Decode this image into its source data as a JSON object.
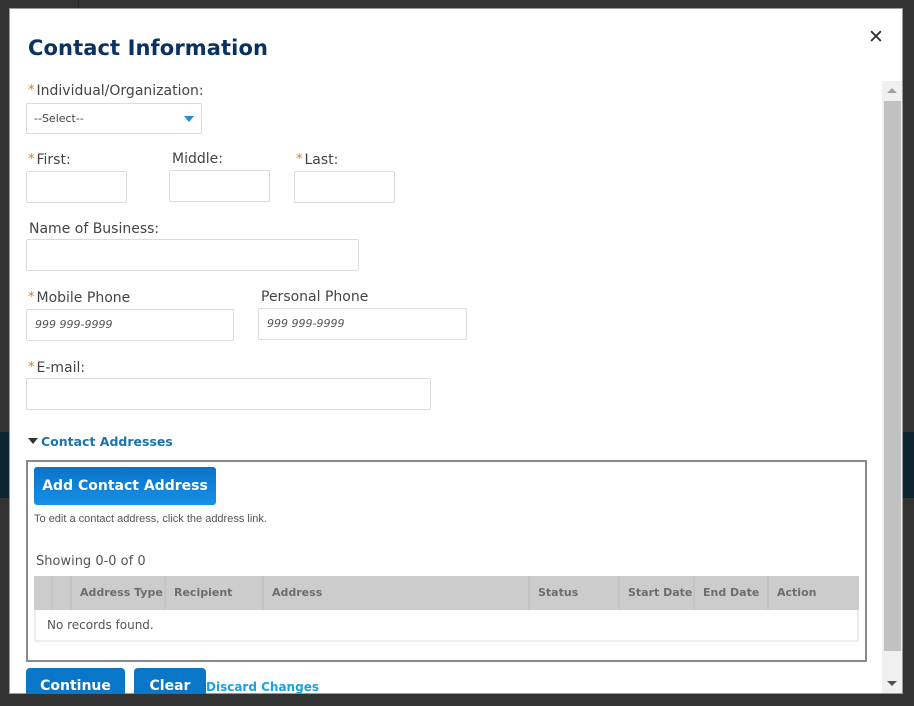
{
  "dialog": {
    "title": "Contact Information",
    "close_icon": "close-icon (×)",
    "close_glyph": "✕"
  },
  "form": {
    "individual_org": {
      "label": "Individual/Organization:",
      "required": true,
      "selected": "--Select--"
    },
    "first": {
      "label": "First:",
      "required": true,
      "value": ""
    },
    "middle": {
      "label": "Middle:",
      "required": false,
      "value": ""
    },
    "last": {
      "label": "Last:",
      "required": true,
      "value": ""
    },
    "business": {
      "label": "Name of Business:",
      "required": false,
      "value": ""
    },
    "mobile_phone": {
      "label": "Mobile Phone",
      "required": true,
      "placeholder": "999 999-9999"
    },
    "personal_phone": {
      "label": "Personal Phone",
      "required": false,
      "placeholder": "999 999-9999"
    },
    "email": {
      "label": "E-mail:",
      "required": true,
      "value": ""
    },
    "required_marker": "*"
  },
  "contact_addresses": {
    "section_label": "Contact Addresses",
    "add_button": "Add Contact Address",
    "hint": "To edit a contact address, click the address link.",
    "showing": "Showing 0-0 of 0",
    "columns": [
      "",
      "",
      "Address Type",
      "Recipient",
      "Address",
      "Status",
      "Start Date",
      "End Date",
      "Action"
    ],
    "empty_message": "No records found."
  },
  "footer": {
    "continue": "Continue",
    "clear": "Clear",
    "discard": "Discard Changes"
  },
  "colors": {
    "title": "#0b3160",
    "accent_button": "#0a76c8",
    "link": "#1b73ae",
    "required": "#e07a1f"
  }
}
